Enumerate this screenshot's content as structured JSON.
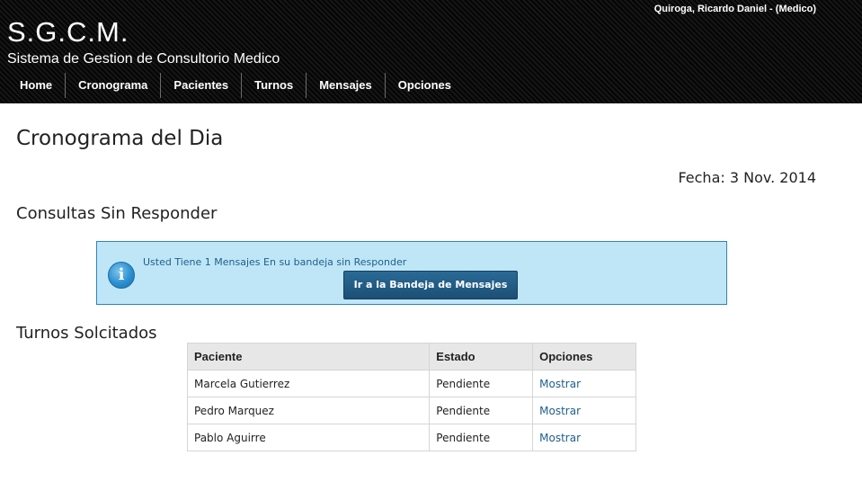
{
  "header": {
    "user": "Quiroga, Ricardo Daniel - (Medico)",
    "logo": "S.G.C.M.",
    "subtitle": "Sistema de Gestion de Consultorio Medico",
    "nav": [
      "Home",
      "Cronograma",
      "Pacientes",
      "Turnos",
      "Mensajes",
      "Opciones"
    ]
  },
  "main": {
    "title": "Cronograma del Dia",
    "fecha_label": "Fecha:",
    "fecha_value": "3 Nov. 2014",
    "consultas": {
      "title": "Consultas Sin Responder",
      "icon": "info-icon",
      "message": "Usted Tiene 1 Mensajes En su bandeja sin Responder",
      "button": "Ir a la Bandeja de Mensajes"
    },
    "turnos": {
      "title": "Turnos Solcitados",
      "columns": [
        "Paciente",
        "Estado",
        "Opciones"
      ],
      "rows": [
        {
          "paciente": "Marcela Gutierrez",
          "estado": "Pendiente",
          "opcion": "Mostrar"
        },
        {
          "paciente": "Pedro Marquez",
          "estado": "Pendiente",
          "opcion": "Mostrar"
        },
        {
          "paciente": "Pablo Aguirre",
          "estado": "Pendiente",
          "opcion": "Mostrar"
        }
      ]
    }
  },
  "colors": {
    "header_bg": "#0b0b0b",
    "alert_bg": "#bfe6f7",
    "alert_border": "#2e84b8",
    "button_bg": "#1f5680",
    "link": "#215f8c"
  }
}
